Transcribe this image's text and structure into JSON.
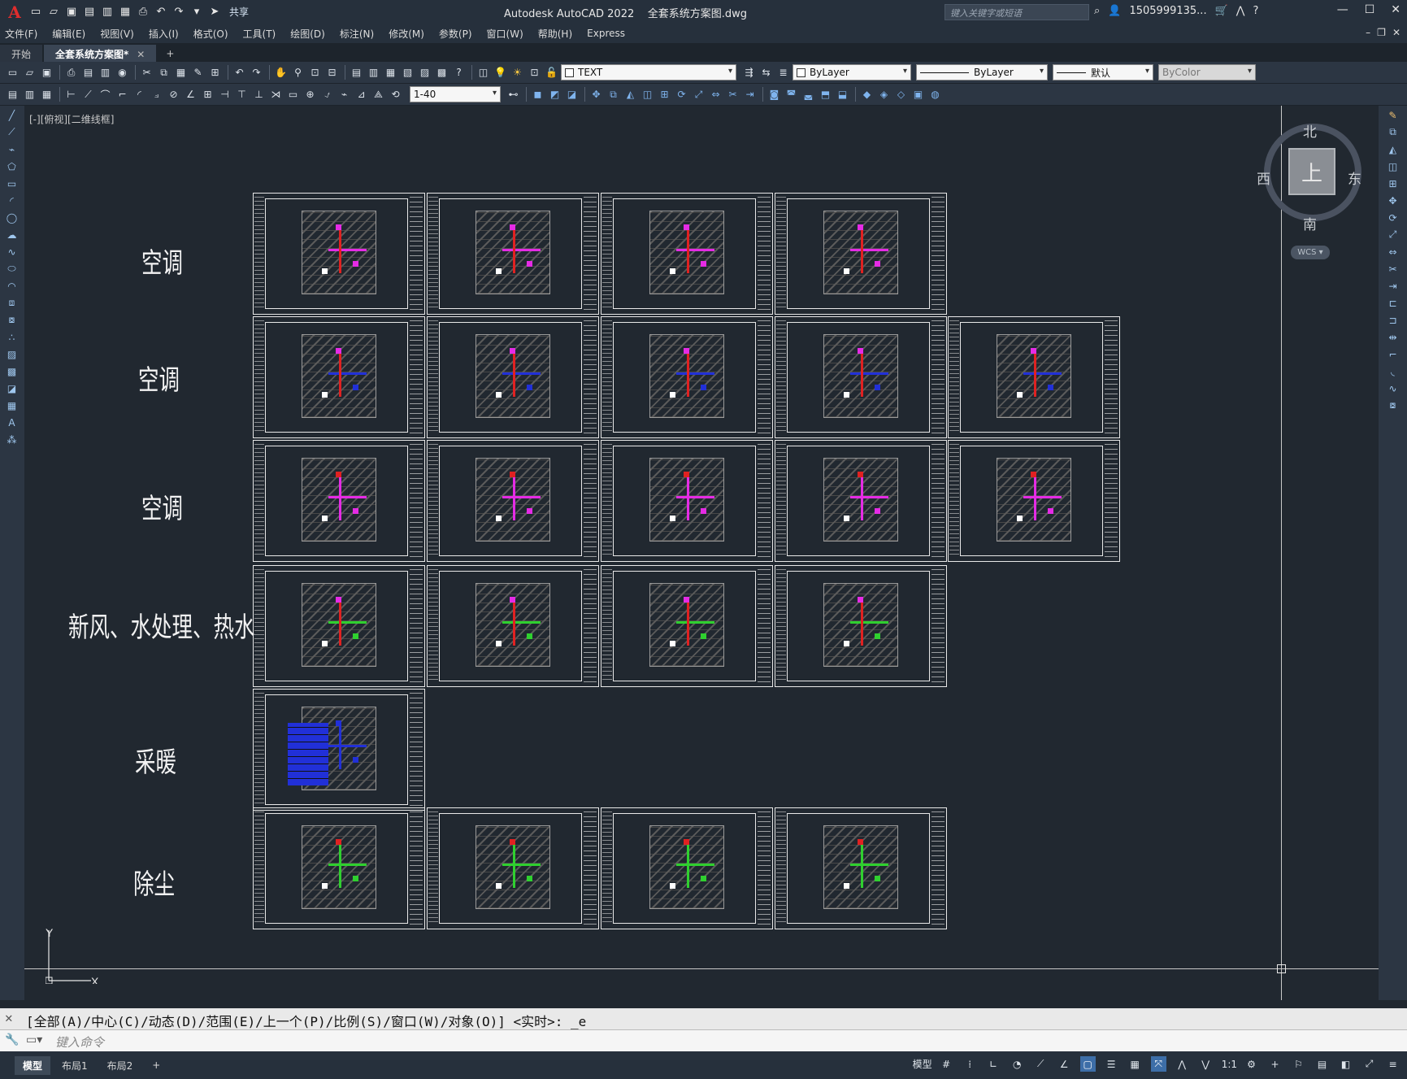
{
  "titlebar": {
    "app_title": "Autodesk AutoCAD 2022",
    "file_name": "全套系统方案图.dwg",
    "share_label": "共享",
    "search_placeholder": "键入关键字或短语",
    "user": "1505999135..."
  },
  "menu": [
    "文件(F)",
    "编辑(E)",
    "视图(V)",
    "插入(I)",
    "格式(O)",
    "工具(T)",
    "绘图(D)",
    "标注(N)",
    "修改(M)",
    "参数(P)",
    "窗口(W)",
    "帮助(H)",
    "Express"
  ],
  "tabs": {
    "start": "开始",
    "drawing": "全套系统方案图*",
    "close": "✕",
    "add": "+"
  },
  "toolbar": {
    "layer_name": "TEXT",
    "color": "ByLayer",
    "linetype": "ByLayer",
    "lineweight": "默认",
    "plotstyle": "ByColor",
    "dimscale": "1-40"
  },
  "viewport_label": "[-][俯视][二维线框]",
  "viewcube": {
    "north": "北",
    "south": "南",
    "east": "东",
    "west": "西",
    "top": "上",
    "wcs": "WCS"
  },
  "row_labels": [
    "空调",
    "空调",
    "空调",
    "新风、水处理、热水",
    "采暖",
    "除尘"
  ],
  "ucs": {
    "x": "X",
    "y": "Y"
  },
  "command": {
    "history": "[全部(A)/中心(C)/动态(D)/范围(E)/上一个(P)/比例(S)/窗口(W)/对象(O)] <实时>: _e",
    "placeholder": "键入命令"
  },
  "layout_tabs": [
    "模型",
    "布局1",
    "布局2"
  ],
  "status": {
    "model": "模型",
    "scale": "1:1"
  },
  "colors": {
    "accent": "#e02d2d",
    "canvas": "#212830",
    "duct_magenta": "#e52be5",
    "duct_blue": "#2130d8",
    "duct_green": "#2fd02f",
    "duct_red": "#e02121"
  }
}
